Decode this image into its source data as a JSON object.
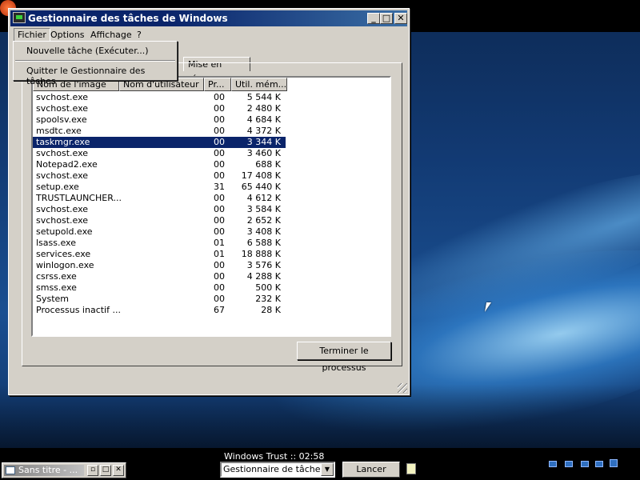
{
  "window": {
    "title": "Gestionnaire des tâches de Windows",
    "controls": {
      "minimize": "_",
      "maximize": "□",
      "close": "✕"
    }
  },
  "menubar": {
    "items": [
      "Fichier",
      "Options",
      "Affichage",
      "?"
    ]
  },
  "file_menu": {
    "items": [
      "Nouvelle tâche (Exécuter...)",
      "Quitter le Gestionnaire des tâches"
    ]
  },
  "tabs": {
    "visible": "Mise en réseau"
  },
  "process_list": {
    "columns": [
      "Nom de l'image",
      "Nom d'utilisateur",
      "Pr...",
      "Util. mém..."
    ],
    "selected_index": 4,
    "rows": [
      {
        "name": "svchost.exe",
        "cpu": "00",
        "mem": "5 544 K"
      },
      {
        "name": "svchost.exe",
        "cpu": "00",
        "mem": "2 480 K"
      },
      {
        "name": "spoolsv.exe",
        "cpu": "00",
        "mem": "4 684 K"
      },
      {
        "name": "msdtc.exe",
        "cpu": "00",
        "mem": "4 372 K"
      },
      {
        "name": "taskmgr.exe",
        "cpu": "00",
        "mem": "3 344 K"
      },
      {
        "name": "svchost.exe",
        "cpu": "00",
        "mem": "3 460 K"
      },
      {
        "name": "Notepad2.exe",
        "cpu": "00",
        "mem": "688 K"
      },
      {
        "name": "svchost.exe",
        "cpu": "00",
        "mem": "17 408 K"
      },
      {
        "name": "setup.exe",
        "cpu": "31",
        "mem": "65 440 K"
      },
      {
        "name": "TRUSTLAUNCHER...",
        "cpu": "00",
        "mem": "4 612 K"
      },
      {
        "name": "svchost.exe",
        "cpu": "00",
        "mem": "3 584 K"
      },
      {
        "name": "svchost.exe",
        "cpu": "00",
        "mem": "2 652 K"
      },
      {
        "name": "setupold.exe",
        "cpu": "00",
        "mem": "3 408 K"
      },
      {
        "name": "lsass.exe",
        "cpu": "01",
        "mem": "6 588 K"
      },
      {
        "name": "services.exe",
        "cpu": "01",
        "mem": "18 888 K"
      },
      {
        "name": "winlogon.exe",
        "cpu": "00",
        "mem": "3 576 K"
      },
      {
        "name": "csrss.exe",
        "cpu": "00",
        "mem": "4 288 K"
      },
      {
        "name": "smss.exe",
        "cpu": "00",
        "mem": "500 K"
      },
      {
        "name": "System",
        "cpu": "00",
        "mem": "232 K"
      },
      {
        "name": "Processus inactif ...",
        "cpu": "67",
        "mem": "28 K"
      }
    ]
  },
  "buttons": {
    "end_process": "Terminer le processus"
  },
  "bottombar": {
    "status": "Windows Trust :: 02:58",
    "combo_value": "Gestionnaire de tâches",
    "launch": "Lancer",
    "mini_window_title": "Sans titre - ..."
  }
}
